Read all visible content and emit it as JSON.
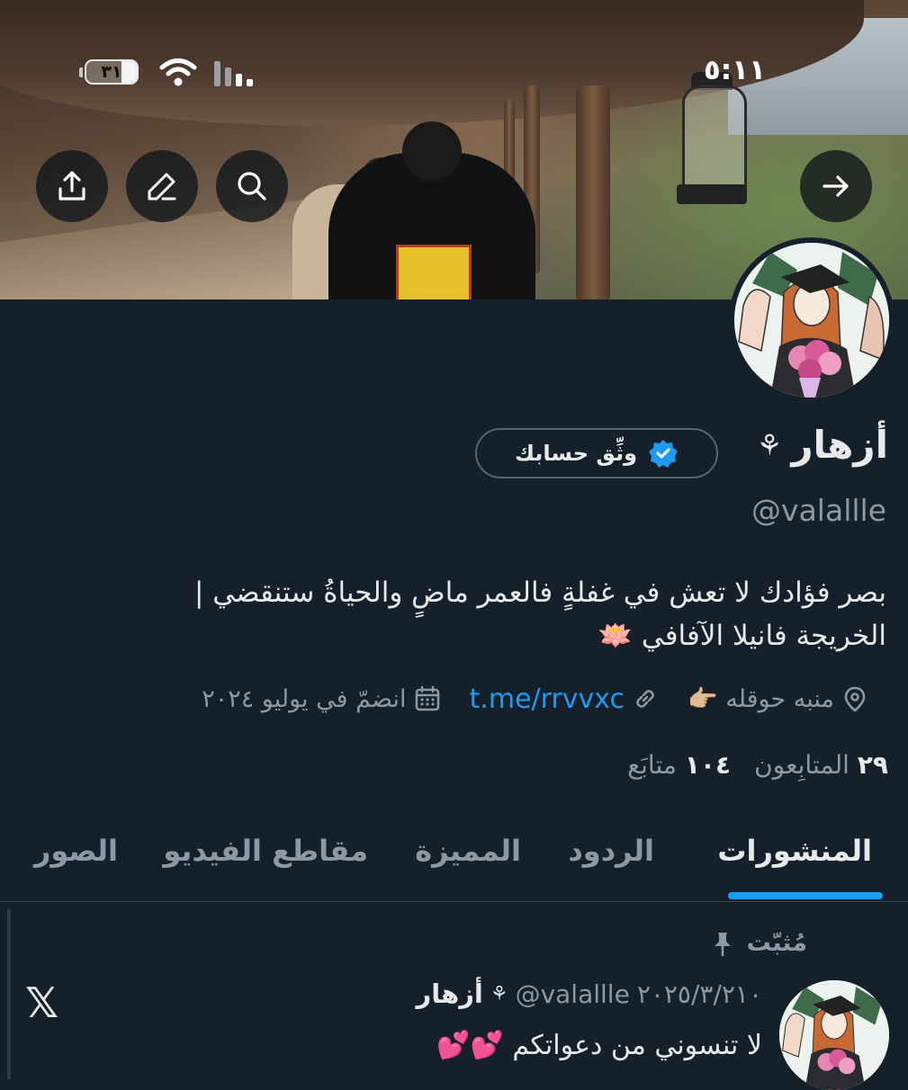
{
  "status_bar": {
    "time": "٥:١١",
    "battery_label": "٣١",
    "battery_level": 0.31
  },
  "header": {
    "back_icon": "arrow-right-icon",
    "search_icon": "search-icon",
    "edit_icon": "pencil-icon",
    "share_icon": "share-icon"
  },
  "profile": {
    "display_name": "أزهار",
    "gender_symbol": "⚘",
    "verify_button_label": "وثِّق حسابك",
    "handle": "@valallle",
    "bio_line1": "بصر فؤادك لا تعش في غفلةٍ فالعمر ماضٍ والحياةُ ستنقضي |",
    "bio_line2": "الخريجة فانيلا الآفافي 🪷",
    "location": "منبه حوقله 👉🏼",
    "link": "t.me/rrvvxc",
    "joined": "انضمّ في يوليو ٢٠٢٤",
    "following_count": "١٠٤",
    "following_label": "متابَع",
    "followers_count": "٢٩",
    "followers_label": "المتابِعون"
  },
  "tabs": [
    {
      "label": "المنشورات",
      "active": true
    },
    {
      "label": "الردود",
      "active": false
    },
    {
      "label": "المميزة",
      "active": false
    },
    {
      "label": "مقاطع الفيديو",
      "active": false
    },
    {
      "label": "الصور",
      "active": false
    }
  ],
  "pinned_post": {
    "pinned_label": "مُثبّت",
    "author_name": "أزهار",
    "author_symbol": "⚘",
    "author_handle": "@valallle",
    "date": "٢٠٢٥/٣/٢١٠",
    "text": "لا تنسوني من دعواتكم 💕💕",
    "source_logo": "𝕏"
  },
  "colors": {
    "background": "#15202b",
    "accent": "#1d9bf0",
    "muted_text": "#8b98a5",
    "verified_badge": "#1d9bf0"
  }
}
